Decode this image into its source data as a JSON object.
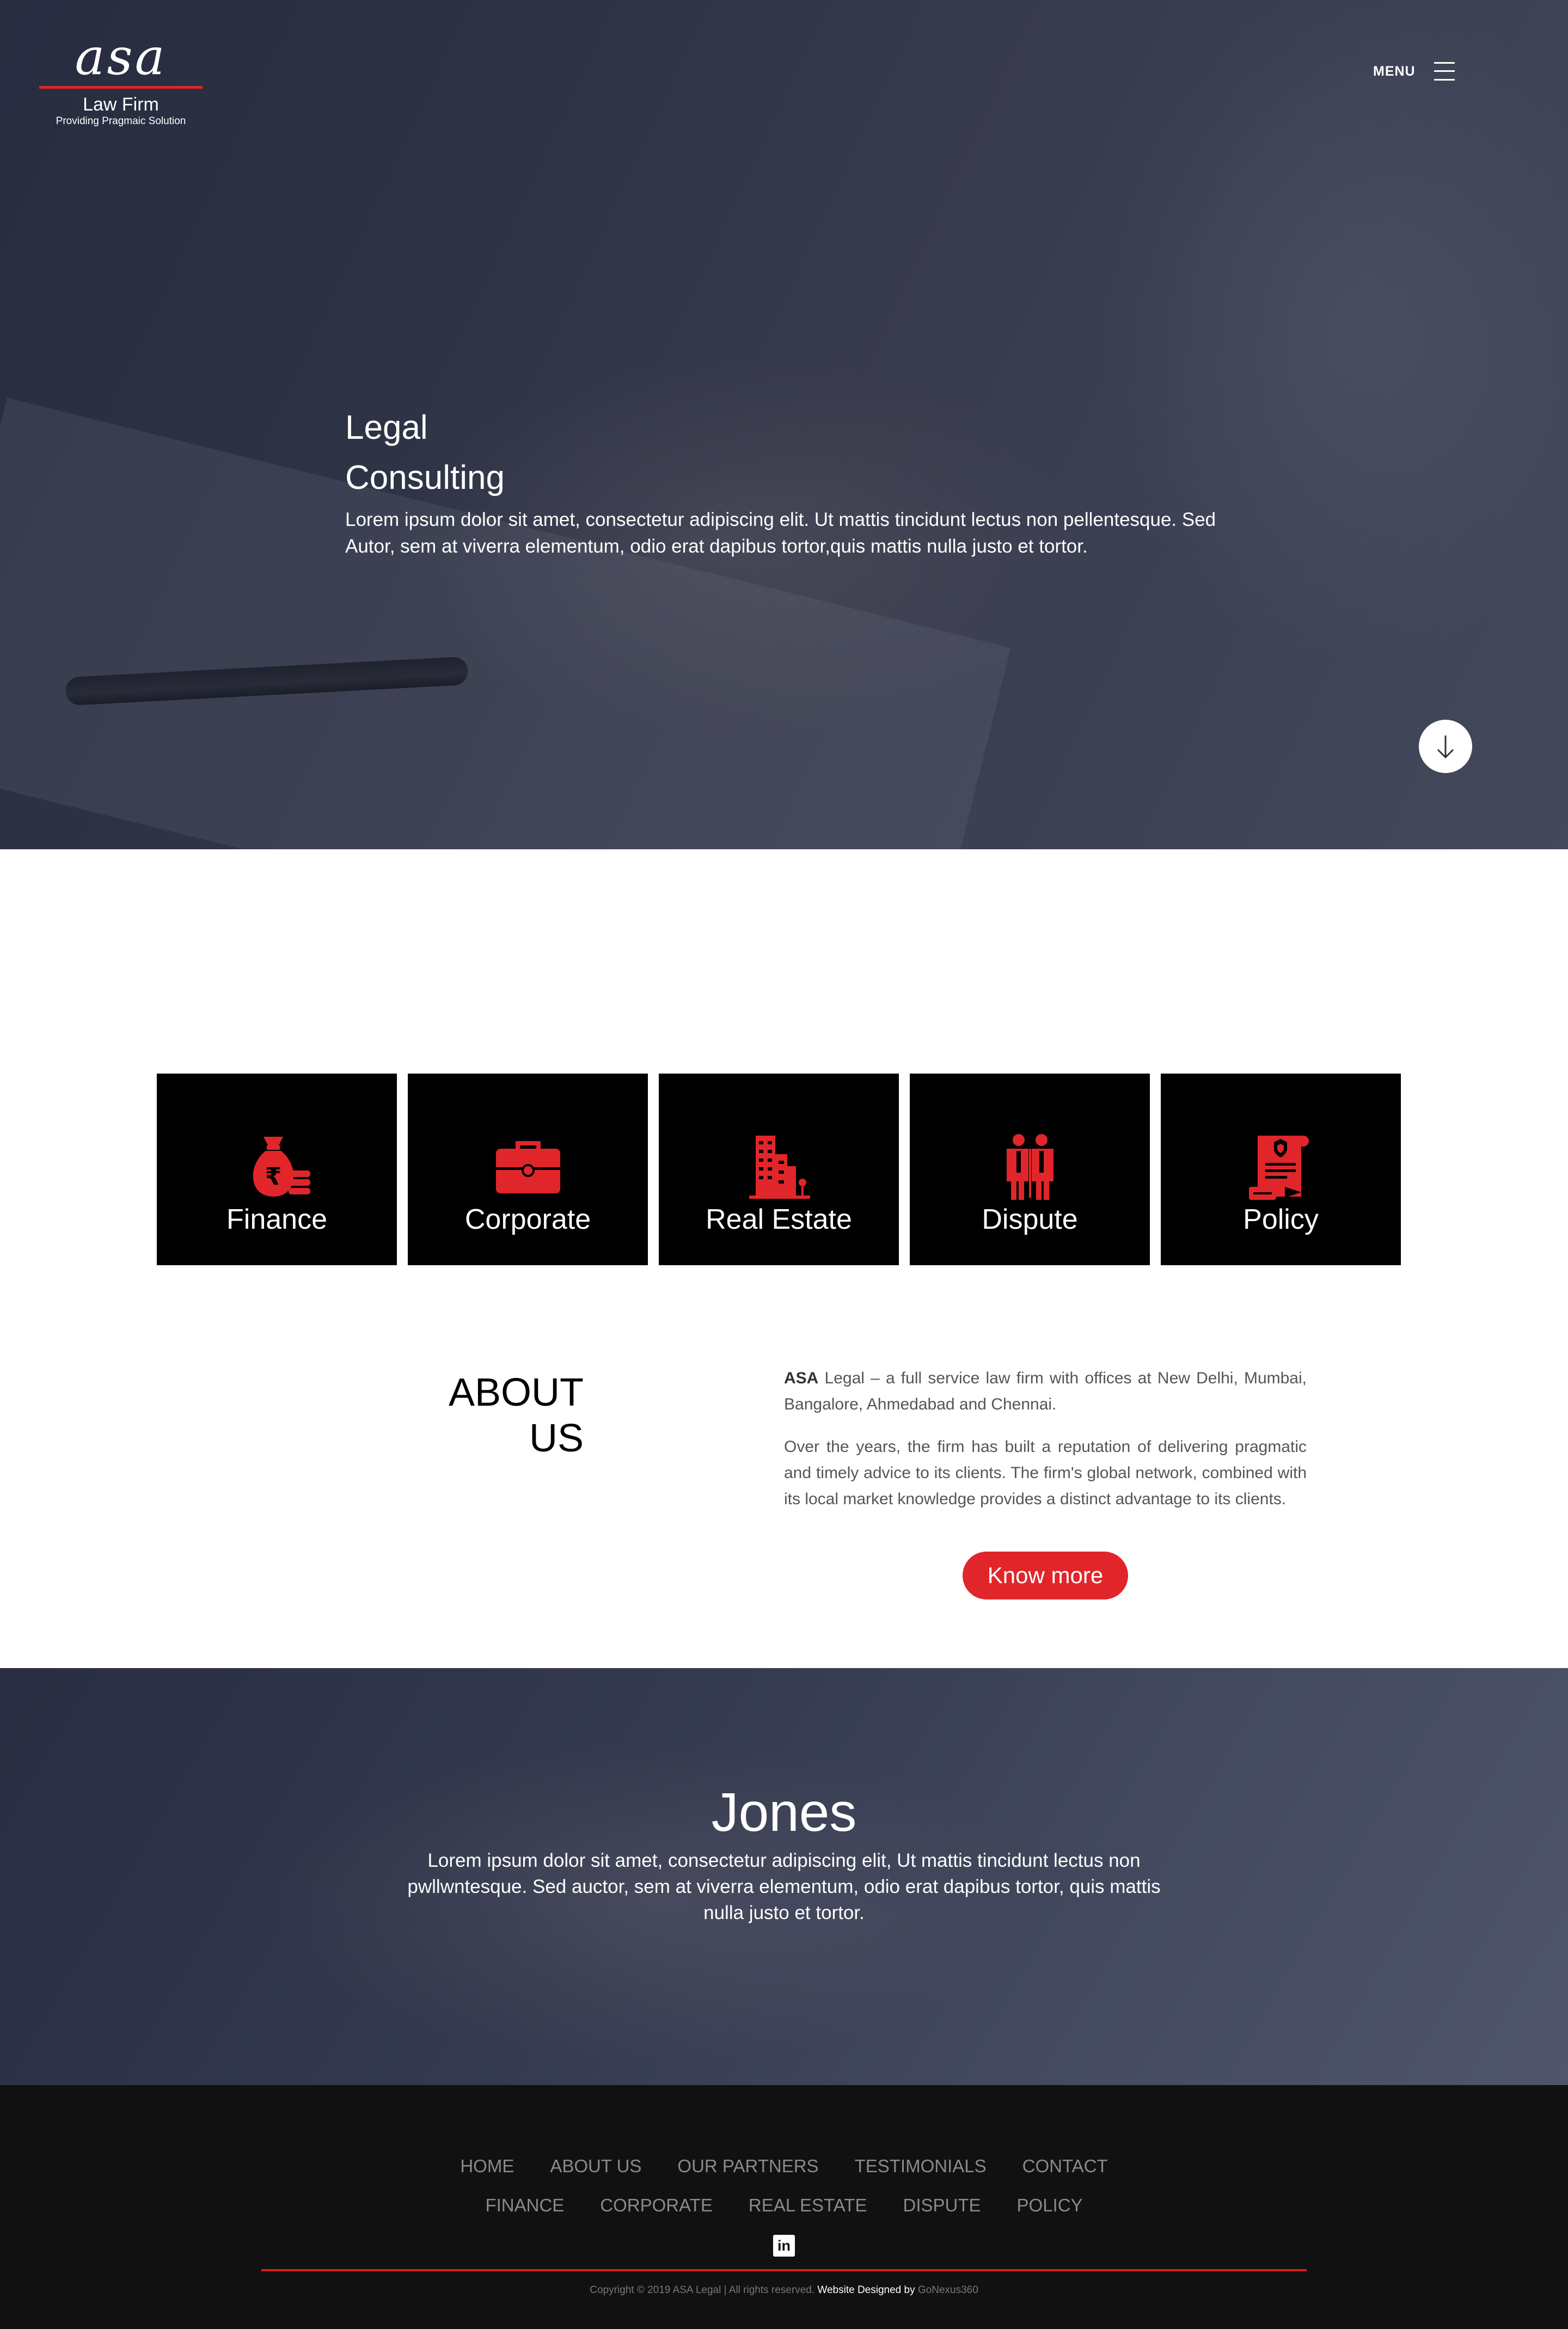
{
  "header": {
    "logo_mark": "asa",
    "logo_name": "Law Firm",
    "logo_tagline": "Providing Pragmaic Solution",
    "menu_label": "MENU"
  },
  "hero": {
    "title_line1": "Legal",
    "title_line2": "Consulting",
    "description": "Lorem ipsum dolor sit amet, consectetur adipiscing elit. Ut mattis tincidunt lectus non pellentesque. Sed Autor, sem at viverra elementum, odio erat dapibus tortor,quis mattis nulla justo et tortor."
  },
  "services": [
    {
      "label": "Finance",
      "icon": "money-bag-icon"
    },
    {
      "label": "Corporate",
      "icon": "briefcase-icon"
    },
    {
      "label": "Real Estate",
      "icon": "buildings-icon"
    },
    {
      "label": "Dispute",
      "icon": "people-dispute-icon"
    },
    {
      "label": "Policy",
      "icon": "policy-document-icon"
    }
  ],
  "about": {
    "title_line1": "ABOUT",
    "title_line2": "US",
    "brand": "ASA",
    "paragraph1_rest": " Legal – a full service law firm with offices at New Delhi, Mumbai, Bangalore, Ahmedabad and Chennai.",
    "paragraph2": "Over the years, the firm has built a reputation of delivering pragmatic and timely advice to its clients. The firm's global network, combined with its local market knowledge provides a distinct advantage to its clients.",
    "button_label": "Know more"
  },
  "testimonial": {
    "name": "Jones",
    "quote": "Lorem ipsum dolor sit amet, consectetur adipiscing elit, Ut mattis tincidunt lectus non pwllwntesque. Sed auctor, sem at viverra elementum, odio erat dapibus tortor, quis mattis nulla justo et tortor."
  },
  "footer": {
    "nav_row1": [
      "HOME",
      "ABOUT US",
      "OUR PARTNERS",
      "TESTIMONIALS",
      "CONTACT"
    ],
    "nav_row2": [
      "FINANCE",
      "CORPORATE",
      "REAL ESTATE",
      "DISPUTE",
      "POLICY"
    ],
    "social_icon": "linkedin-icon",
    "social_label": "in",
    "copyright": "Copyright © 2019 ASA Legal | All rights reserved.",
    "designed_by": "Website Designed by",
    "designer": "GoNexus360"
  },
  "colors": {
    "accent_red": "#e0262a",
    "card_bg": "#000000",
    "footer_bg": "#111112"
  }
}
